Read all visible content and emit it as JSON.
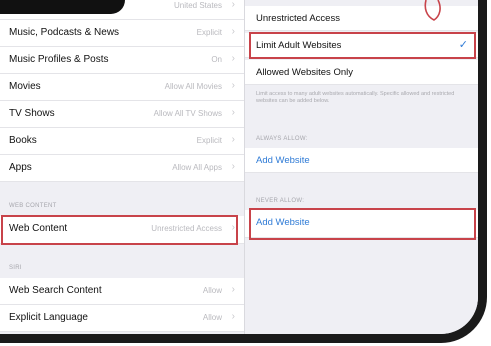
{
  "left_rows": [
    {
      "label": "",
      "value": "United States"
    },
    {
      "label": "Music, Podcasts & News",
      "value": "Explicit"
    },
    {
      "label": "Music Profiles & Posts",
      "value": "On"
    },
    {
      "label": "Movies",
      "value": "Allow All Movies"
    },
    {
      "label": "TV Shows",
      "value": "Allow All TV Shows"
    },
    {
      "label": "Books",
      "value": "Explicit"
    },
    {
      "label": "Apps",
      "value": "Allow All Apps"
    }
  ],
  "web_content_header": "WEB CONTENT",
  "web_content_row": {
    "label": "Web Content",
    "value": "Unrestricted Access"
  },
  "siri_header": "SIRI",
  "siri_rows": [
    {
      "label": "Web Search Content",
      "value": "Allow"
    },
    {
      "label": "Explicit Language",
      "value": "Allow"
    }
  ],
  "right_options": [
    {
      "label": "Unrestricted Access"
    },
    {
      "label": "Limit Adult Websites"
    },
    {
      "label": "Allowed Websites Only"
    }
  ],
  "right_note": "Limit access to many adult websites automatically. Specific allowed and restricted websites can be added below.",
  "always_allow_header": "ALWAYS ALLOW:",
  "always_allow_add": "Add Website",
  "never_allow_header": "NEVER ALLOW:",
  "never_allow_add": "Add Website",
  "chevron_glyph": "›",
  "check_glyph": "✓",
  "colors": {
    "highlight": "#c8434a",
    "link": "#2f7bd6",
    "bezel": "#1a1a1a"
  }
}
